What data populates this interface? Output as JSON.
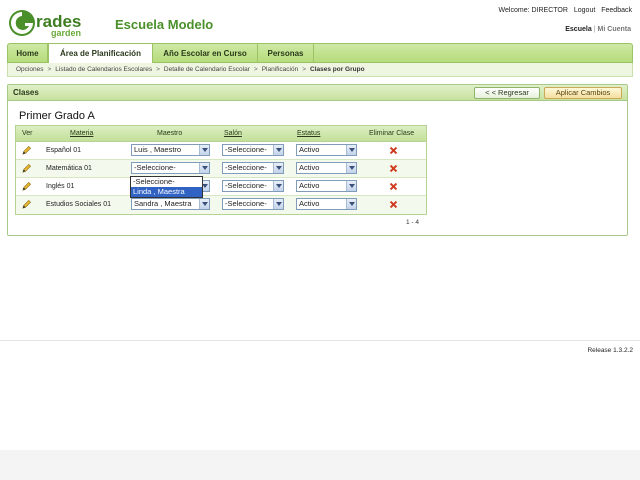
{
  "header": {
    "logo_text": "Grades garden",
    "school_name": "Escuela Modelo",
    "welcome": "Welcome: DIRECTOR",
    "logout": "Logout",
    "feedback": "Feedback",
    "school_link": "Escuela",
    "account_link": "Mi Cuenta"
  },
  "nav": {
    "tabs": [
      {
        "label": "Home"
      },
      {
        "label": "Área de Planificación"
      },
      {
        "label": "Año Escolar en Curso"
      },
      {
        "label": "Personas"
      }
    ],
    "active_index": 1
  },
  "breadcrumb": [
    "Opciones",
    "Listado de Calendarios Escolares",
    "Detalle de Calendario Escolar",
    "Planificación",
    "Clases por Grupo"
  ],
  "panel": {
    "title": "Clases",
    "back_label": "< < Regresar",
    "apply_label": "Aplicar Cambios",
    "group_title": "Primer Grado A"
  },
  "grid": {
    "columns": {
      "ver": "Ver",
      "materia": "Materia",
      "maestro": "Maestro",
      "salon": "Salón",
      "estatus": "Estatus",
      "eliminar": "Eliminar Clase"
    },
    "rows": [
      {
        "materia": "Español 01",
        "maestro": "Luis , Maestro",
        "salon": "-Seleccione-",
        "estatus": "Activo"
      },
      {
        "materia": "Matemática 01",
        "maestro": "-Seleccione-",
        "salon": "-Seleccione-",
        "estatus": "Activo"
      },
      {
        "materia": "Inglés 01",
        "maestro": "",
        "salon": "-Seleccione-",
        "estatus": "Activo"
      },
      {
        "materia": "Estudios Sociales 01",
        "maestro": "Sandra , Maestra",
        "salon": "-Seleccione-",
        "estatus": "Activo"
      }
    ],
    "pager": "1 - 4"
  },
  "dropdown_open": {
    "options": [
      "-Seleccione-",
      "Linda , Maestra"
    ],
    "highlighted_index": 1
  },
  "footer": {
    "release": "Release 1.3.2.2"
  },
  "colors": {
    "brand_green": "#4a8f2a",
    "nav_green": "#b6dc7a",
    "delete_red": "#d03a1e",
    "highlight_blue": "#3163c5"
  }
}
